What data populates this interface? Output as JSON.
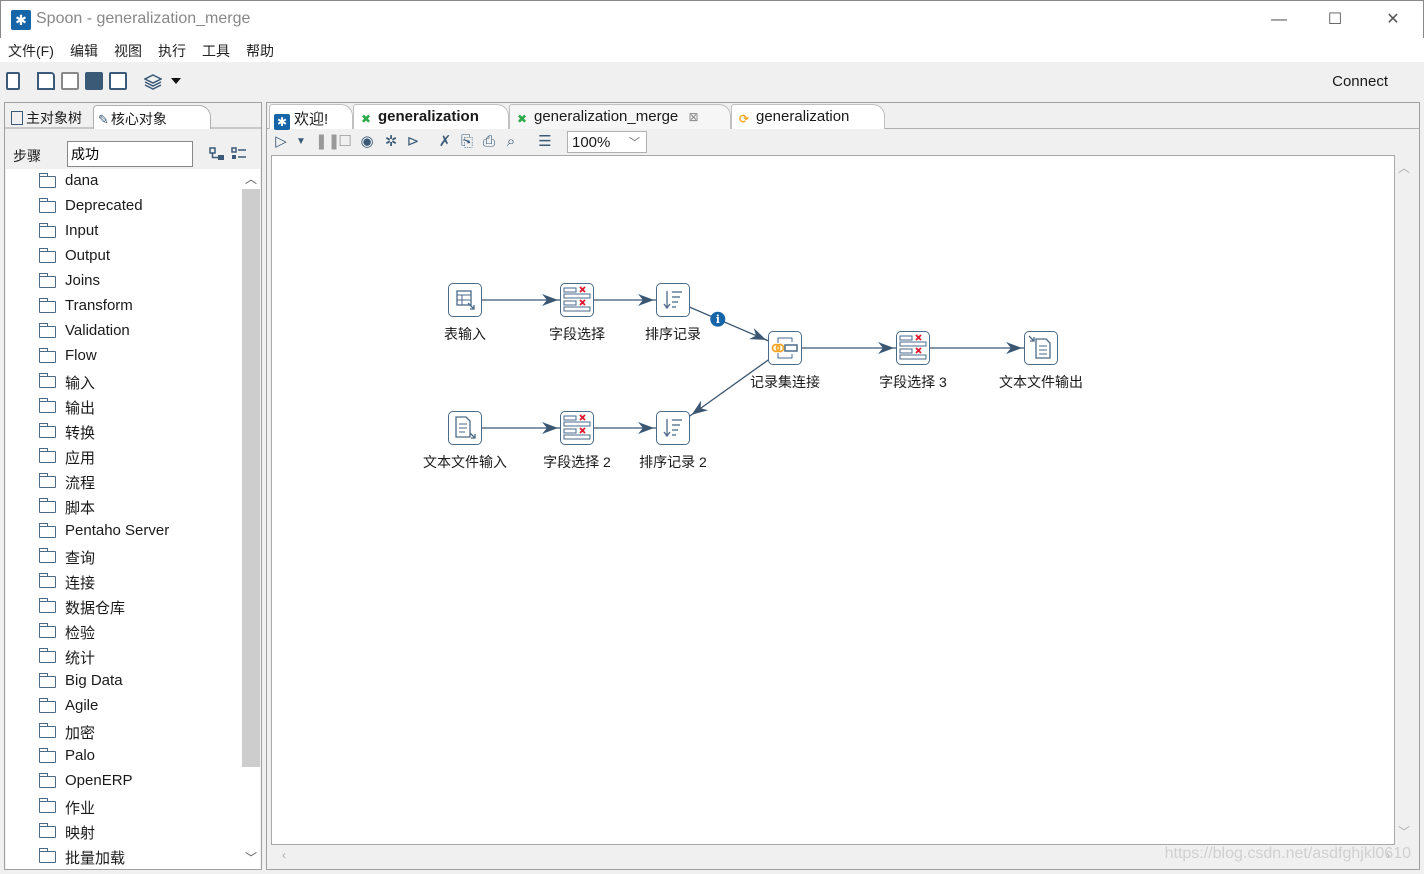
{
  "window": {
    "title": "Spoon - generalization_merge",
    "controls": [
      "minimize",
      "maximize",
      "close"
    ]
  },
  "menubar": {
    "items": [
      "文件(F)",
      "编辑",
      "视图",
      "执行",
      "工具",
      "帮助"
    ]
  },
  "toolbar": {
    "icons": [
      "new-file-icon",
      "open-file-icon",
      "explore-repository-icon",
      "save-icon",
      "save-as-icon",
      "layers-icon",
      "dropdown-arrow-icon"
    ],
    "connect_label": "Connect"
  },
  "left_panel": {
    "tabs": [
      {
        "label": "主对象树",
        "icon": "tree-view-icon",
        "active": false
      },
      {
        "label": "核心对象",
        "icon": "pencil-icon",
        "active": true
      }
    ],
    "steps_label": "步骤",
    "search_value": "成功",
    "tree_items": [
      "dana",
      "Deprecated",
      "Input",
      "Output",
      "Joins",
      "Transform",
      "Validation",
      "Flow",
      "输入",
      "输出",
      "转换",
      "应用",
      "流程",
      "脚本",
      "Pentaho Server",
      "查询",
      "连接",
      "数据仓库",
      "检验",
      "统计",
      "Big Data",
      "Agile",
      "加密",
      "Palo",
      "OpenERP",
      "作业",
      "映射",
      "批量加载"
    ]
  },
  "editor": {
    "tabs": [
      {
        "label": "欢迎!",
        "icon": "spoon-icon",
        "active": false,
        "closable": false
      },
      {
        "label": "generalization",
        "icon": "transformation-icon",
        "active": true,
        "closable": false
      },
      {
        "label": "generalization_merge",
        "icon": "transformation-icon",
        "active": false,
        "closable": true
      },
      {
        "label": "generalization",
        "icon": "job-icon",
        "active": false,
        "closable": false
      }
    ],
    "canvas_toolbar": {
      "icons": [
        "run-icon",
        "run-dropdown-icon",
        "pause-icon",
        "stop-icon",
        "preview-icon",
        "debug-icon",
        "replay-icon",
        "verify-icon",
        "impact-icon",
        "sql-icon",
        "explore-db-icon",
        "show-results-icon"
      ],
      "zoom": "100%"
    },
    "steps": [
      {
        "id": "table-input",
        "label": "表输入",
        "type": "table-input"
      },
      {
        "id": "select-values",
        "label": "字段选择",
        "type": "select-values"
      },
      {
        "id": "sort-rows",
        "label": "排序记录",
        "type": "sort-rows"
      },
      {
        "id": "merge-join",
        "label": "记录集连接",
        "type": "merge-join"
      },
      {
        "id": "select-values-3",
        "label": "字段选择 3",
        "type": "select-values"
      },
      {
        "id": "text-file-output",
        "label": "文本文件输出",
        "type": "text-file-output"
      },
      {
        "id": "text-file-input",
        "label": "文本文件输入",
        "type": "text-file-input"
      },
      {
        "id": "select-values-2",
        "label": "字段选择 2",
        "type": "select-values"
      },
      {
        "id": "sort-rows-2",
        "label": "排序记录 2",
        "type": "sort-rows"
      }
    ],
    "hops": [
      {
        "from": "table-input",
        "to": "select-values"
      },
      {
        "from": "select-values",
        "to": "sort-rows"
      },
      {
        "from": "sort-rows",
        "to": "merge-join",
        "info": true
      },
      {
        "from": "merge-join",
        "to": "select-values-3"
      },
      {
        "from": "select-values-3",
        "to": "text-file-output"
      },
      {
        "from": "text-file-input",
        "to": "select-values-2"
      },
      {
        "from": "select-values-2",
        "to": "sort-rows-2"
      },
      {
        "from": "merge-join",
        "to": "sort-rows-2"
      }
    ],
    "watermark": "https://blog.csdn.net/asdfghjkl0610"
  },
  "colors": {
    "accent": "#1565a8",
    "step_border": "#4a6a88",
    "hop": "#3a5670",
    "delete_red": "#e0182b",
    "join_orange": "#f5a623"
  }
}
